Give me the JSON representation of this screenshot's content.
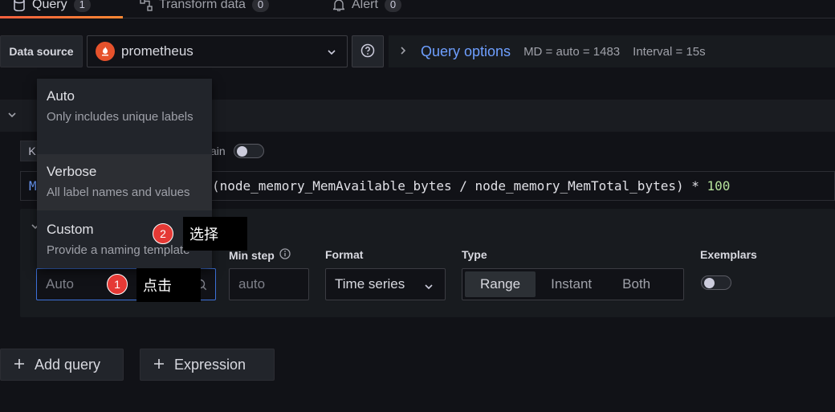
{
  "tabs": [
    {
      "label": "Query",
      "count": "1"
    },
    {
      "label": "Transform data",
      "count": "0"
    },
    {
      "label": "Alert",
      "count": "0"
    }
  ],
  "datasource": {
    "label": "Data source",
    "value": "prometheus"
  },
  "query_options": {
    "title": "Query options",
    "md": "MD = auto = 1483",
    "interval": "Interval = 15s"
  },
  "toolbar": {
    "kick_label": "K",
    "explain_label": "ain"
  },
  "editor": {
    "prefix": "M",
    "expression": "(node_memory_MemAvailable_bytes / node_memory_MemTotal_bytes) * ",
    "number": "100"
  },
  "options": {
    "legend_placeholder": "Auto",
    "min_step_label": "Min step",
    "min_step_placeholder": "auto",
    "format_label": "Format",
    "format_value": "Time series",
    "type_label": "Type",
    "types": [
      "Range",
      "Instant",
      "Both"
    ],
    "exemplars_label": "Exemplars"
  },
  "legend_menu": [
    {
      "title": "Auto",
      "description": "Only includes unique labels"
    },
    {
      "title": "Verbose",
      "description": "All label names and values"
    },
    {
      "title": "Custom",
      "description": "Provide a naming template"
    }
  ],
  "buttons": {
    "add_query": "Add query",
    "expression": "Expression"
  },
  "annotations": [
    {
      "number": "1",
      "text": "点击"
    },
    {
      "number": "2",
      "text": "选择"
    }
  ],
  "colors": {
    "accent_link": "#6e9fff",
    "tab_underline": "#f55f3e",
    "annotation_badge": "#e53935"
  }
}
